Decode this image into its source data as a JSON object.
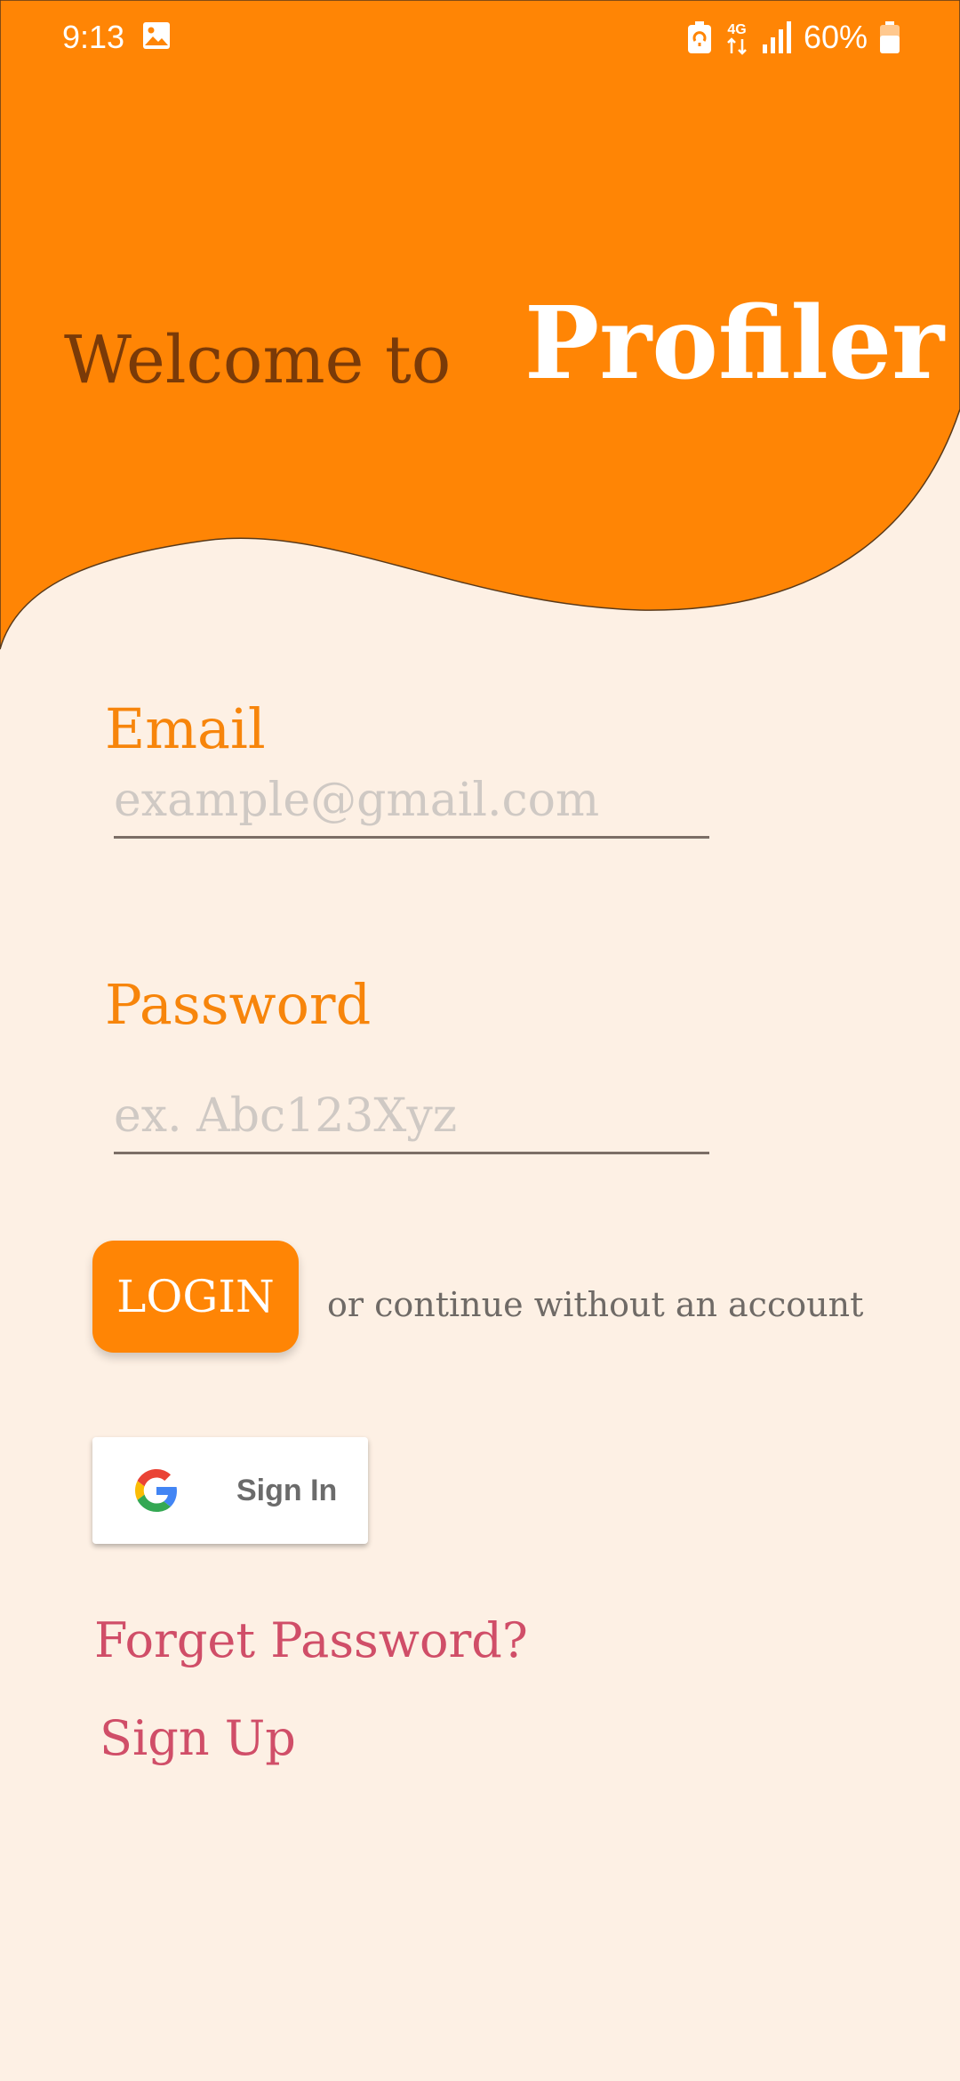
{
  "status_bar": {
    "time": "9:13",
    "battery": "60%",
    "network": "4G",
    "icons": [
      "gallery-icon",
      "battery-saver-icon",
      "network-4g-icon",
      "signal-icon",
      "battery-icon"
    ]
  },
  "header": {
    "welcome": "Welcome to",
    "app_name": "Profiler",
    "color": "#ff8505"
  },
  "form": {
    "email_label": "Email",
    "email_placeholder": "example@gmail.com",
    "email_value": "",
    "password_label": "Password",
    "password_placeholder": "ex. Abc123Xyz",
    "password_value": ""
  },
  "actions": {
    "login_label": "LOGIN",
    "continue_text": "or continue without an account",
    "google_sign_in": "Sign In",
    "forget_password": "Forget Password?",
    "sign_up": "Sign Up"
  },
  "colors": {
    "accent": "#ff8505",
    "background": "#fdf0e4",
    "link": "#d04e68",
    "welcome_text": "#7a3a08"
  }
}
